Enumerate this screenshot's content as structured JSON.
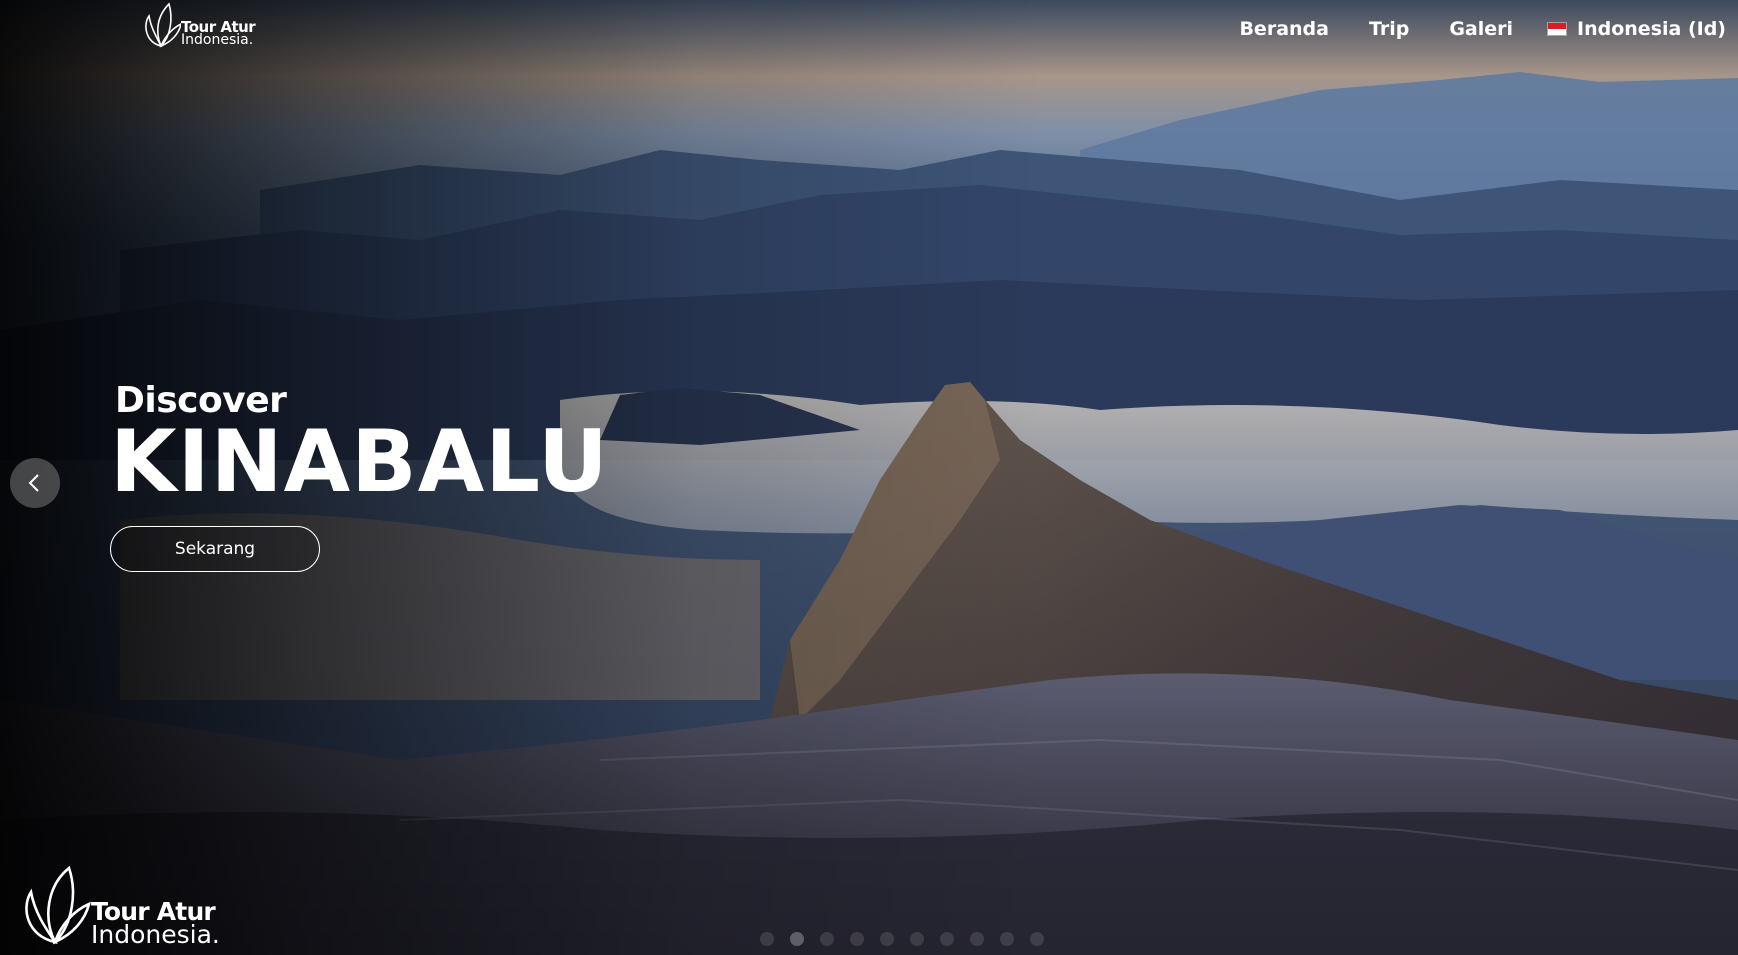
{
  "brand": {
    "line1": "Tour Atur",
    "line2": "Indonesia."
  },
  "nav": {
    "items": [
      "Beranda",
      "Trip",
      "Galeri"
    ],
    "language": "Indonesia (Id)"
  },
  "hero": {
    "eyebrow": "Discover",
    "headline": "KINABALU",
    "cta_label": "Sekarang"
  },
  "icons": {
    "prev": "chevron-left-icon",
    "logo": "leaf-logo-icon",
    "flag": "indonesia-flag-icon"
  },
  "colors": {
    "text": "#ffffff",
    "flag_red": "#e11b22",
    "flag_white": "#ffffff"
  },
  "slider": {
    "count": 10,
    "active": 1
  }
}
